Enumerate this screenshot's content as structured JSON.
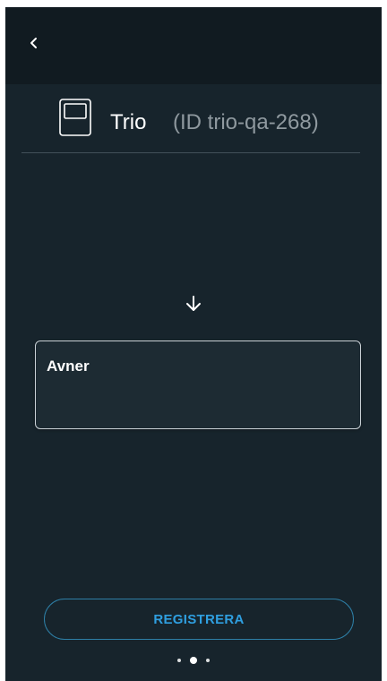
{
  "header": {
    "back_icon": "chevron-left-icon"
  },
  "device": {
    "icon": "intercom-monitor-icon",
    "name": "Trio",
    "id_label": "(ID trio-qa-268)"
  },
  "flow": {
    "arrow_icon": "arrow-down-icon"
  },
  "name_card": {
    "label": "Avner"
  },
  "actions": {
    "register_label": "REGISTRERA"
  },
  "pager": {
    "total": 3,
    "active_index": 1
  },
  "colors": {
    "background": "#17242c",
    "topbar": "#111b21",
    "accent": "#2f9fe0",
    "secondary_text": "#8f999f"
  }
}
